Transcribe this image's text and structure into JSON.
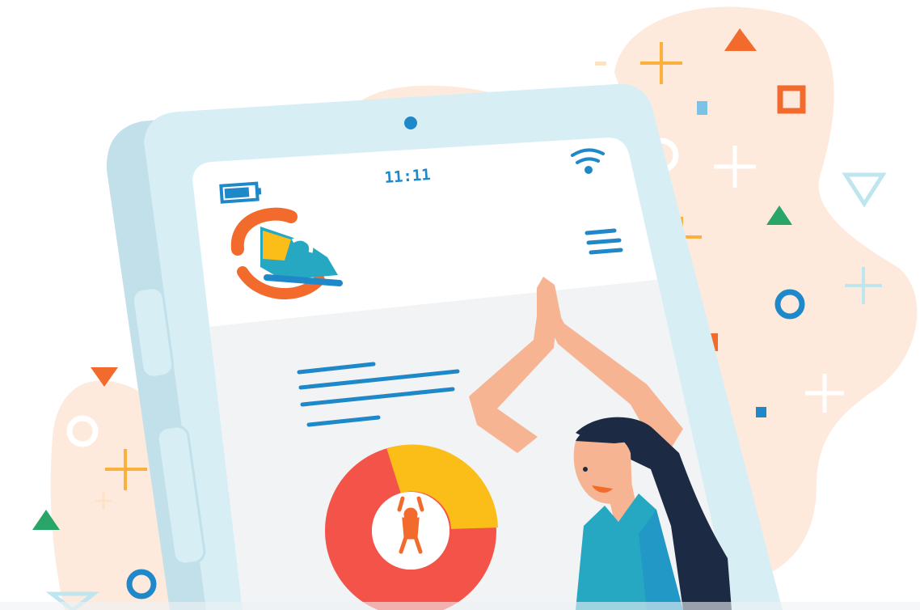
{
  "phone": {
    "status_time": "11:11",
    "icons": [
      "battery-icon",
      "wifi-icon",
      "menu-icon",
      "sneaker-logo-icon",
      "person-exercising-icon"
    ]
  },
  "colors": {
    "blob": "#fdeadd",
    "phone_frame": "#d8eef5",
    "phone_frame_dark": "#c2e0ea",
    "screen": "#ffffff",
    "screen_lower": "#f1f3f4",
    "accent_blue": "#1e88c9",
    "accent_orange": "#f26b2d",
    "donut_red": "#f4534a",
    "donut_yellow": "#fbbd17",
    "skin": "#f6b492",
    "hair": "#1d2a44",
    "top": "#27a8c2",
    "green": "#2aa56a",
    "orange_cross": "#fbb03b"
  }
}
